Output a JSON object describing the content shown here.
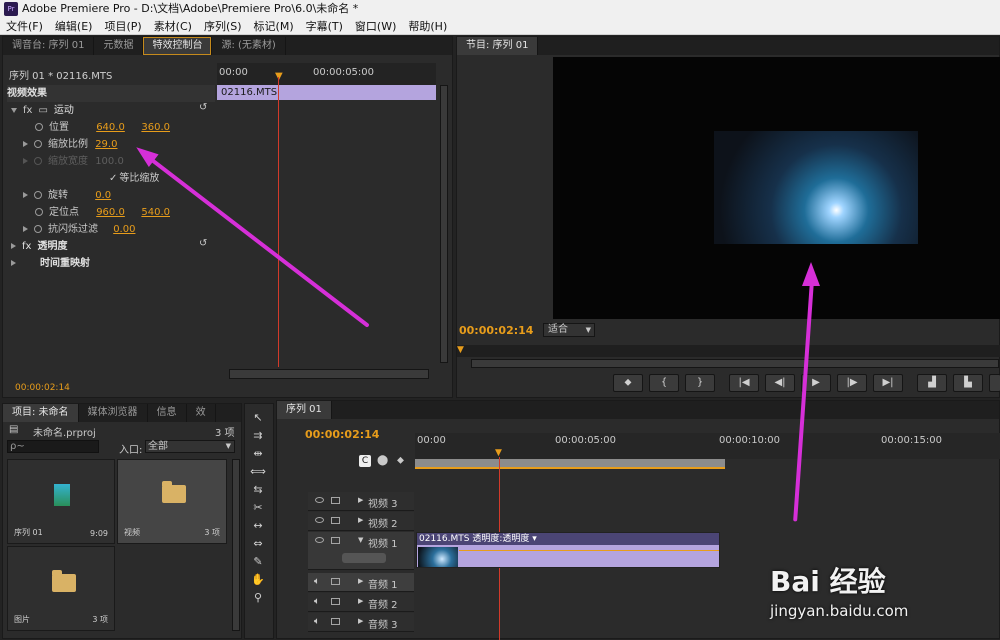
{
  "window": {
    "title": "Adobe Premiere Pro - D:\\文档\\Adobe\\Premiere Pro\\6.0\\未命名 *",
    "logo": "Pr"
  },
  "menu": [
    "文件(F)",
    "编辑(E)",
    "项目(P)",
    "素材(C)",
    "序列(S)",
    "标记(M)",
    "字幕(T)",
    "窗口(W)",
    "帮助(H)"
  ],
  "effects_panel": {
    "tabs": [
      "调音台: 序列 01",
      "元数据",
      "特效控制台",
      "源: (无素材)"
    ],
    "header_seq": "序列 01 * 02116.MTS",
    "ruler": [
      "00:00",
      "00:00:05:00"
    ],
    "clip_name": "02116.MTS",
    "section": "视频效果",
    "motion": "运动",
    "position_label": "位置",
    "position_x": "640.0",
    "position_y": "360.0",
    "scale_label": "缩放比例",
    "scale_val": "29.0",
    "scale_w_label": "缩放宽度",
    "scale_w_val": "100.0",
    "uniform_label": "等比缩放",
    "rotation_label": "旋转",
    "rotation_val": "0.0",
    "anchor_label": "定位点",
    "anchor_x": "960.0",
    "anchor_y": "540.0",
    "flicker_label": "抗闪烁过滤",
    "flicker_val": "0.00",
    "opacity": "透明度",
    "timeremap": "时间重映射",
    "timecode": "00:00:02:14"
  },
  "program_monitor": {
    "tab": "节目: 序列 01",
    "timecode": "00:00:02:14",
    "fit": "适合"
  },
  "project_panel": {
    "tabs": [
      "项目: 未命名",
      "媒体浏览器",
      "信息",
      "效"
    ],
    "file": "未命名.prproj",
    "count": "3 项",
    "entry_label": "入口:",
    "entry_value": "全部",
    "search_placeholder": "ρ~",
    "items": [
      {
        "name": "序列 01",
        "meta": "9:09"
      },
      {
        "name": "视频",
        "meta": "3 项"
      },
      {
        "name": "图片",
        "meta": "3 项"
      }
    ]
  },
  "timeline": {
    "tab": "序列 01",
    "timecode": "00:00:02:14",
    "ruler": [
      "00:00",
      "00:00:05:00",
      "00:00:10:00",
      "00:00:15:00"
    ],
    "video_tracks": [
      "视频 3",
      "视频 2",
      "视频 1"
    ],
    "audio_tracks": [
      "音频 1",
      "音频 2",
      "音频 3"
    ],
    "clip_label": "02116.MTS 透明度:透明度 ▾"
  },
  "watermark": {
    "brand": "Bai 经验",
    "url": "jingyan.baidu.com"
  },
  "colors": {
    "accent": "#e89d1b",
    "clip": "#b4a4de",
    "arrow": "#d62fd8",
    "playhead": "#d23a2a"
  }
}
